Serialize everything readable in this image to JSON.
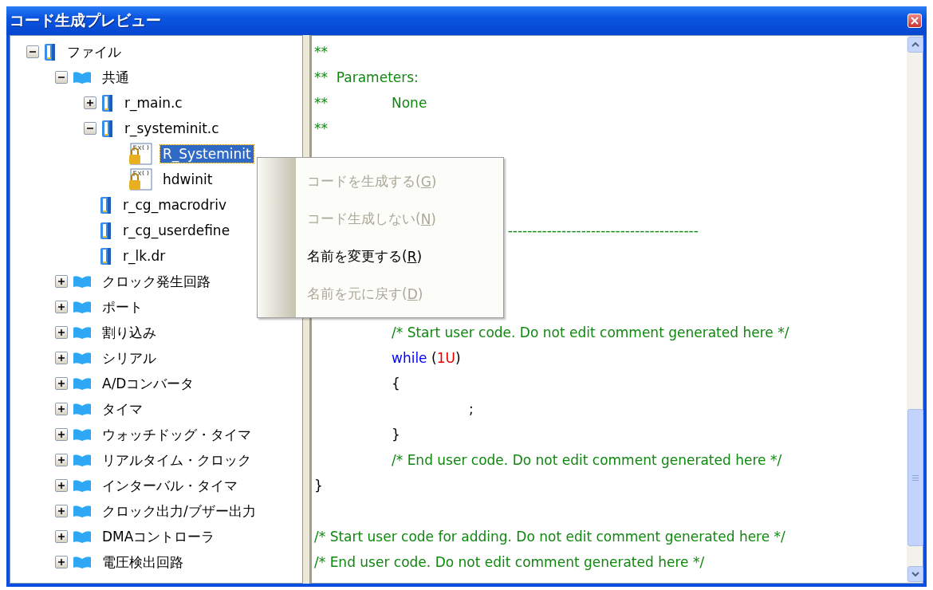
{
  "window": {
    "title": "コード生成プレビュー"
  },
  "tree": [
    {
      "label": "ファイル",
      "kind": "file",
      "expanded": true,
      "selected": false,
      "children": [
        {
          "label": "共通",
          "kind": "folder",
          "expanded": true,
          "selected": false,
          "children": [
            {
              "label": "r_main.c",
              "kind": "file",
              "expanded": false,
              "selected": false
            },
            {
              "label": "r_systeminit.c",
              "kind": "file",
              "expanded": true,
              "selected": false,
              "children": [
                {
                  "label": "R_Systeminit",
                  "kind": "function",
                  "selected": true
                },
                {
                  "label": "hdwinit",
                  "kind": "function",
                  "selected": false
                }
              ]
            },
            {
              "label": "r_cg_macrodriv",
              "kind": "file",
              "selected": false
            },
            {
              "label": "r_cg_userdefine",
              "kind": "file",
              "selected": false
            },
            {
              "label": "r_lk.dr",
              "kind": "file",
              "selected": false
            }
          ]
        },
        {
          "label": "クロック発生回路",
          "kind": "folder",
          "expanded": false,
          "selected": false
        },
        {
          "label": "ポート",
          "kind": "folder",
          "expanded": false,
          "selected": false
        },
        {
          "label": "割り込み",
          "kind": "folder",
          "expanded": false,
          "selected": false
        },
        {
          "label": "シリアル",
          "kind": "folder",
          "expanded": false,
          "selected": false
        },
        {
          "label": "A/Dコンバータ",
          "kind": "folder",
          "expanded": false,
          "selected": false
        },
        {
          "label": "タイマ",
          "kind": "folder",
          "expanded": false,
          "selected": false
        },
        {
          "label": "ウォッチドッグ・タイマ",
          "kind": "folder",
          "expanded": false,
          "selected": false
        },
        {
          "label": "リアルタイム・クロック",
          "kind": "folder",
          "expanded": false,
          "selected": false
        },
        {
          "label": "インターバル・タイマ",
          "kind": "folder",
          "expanded": false,
          "selected": false
        },
        {
          "label": "クロック出力/ブザー出力",
          "kind": "folder",
          "expanded": false,
          "selected": false
        },
        {
          "label": "DMAコントローラ",
          "kind": "folder",
          "expanded": false,
          "selected": false
        },
        {
          "label": "電圧検出回路",
          "kind": "folder",
          "expanded": false,
          "selected": false
        }
      ]
    }
  ],
  "code": [
    {
      "kind": "code",
      "segments": [
        {
          "kind": "comment",
          "text": "**"
        }
      ]
    },
    {
      "kind": "code",
      "segments": [
        {
          "kind": "comment",
          "text": "**  Parameters:"
        }
      ]
    },
    {
      "kind": "code",
      "segments": [
        {
          "kind": "comment",
          "text": "**\tNone"
        }
      ]
    },
    {
      "kind": "code",
      "segments": [
        {
          "kind": "comment",
          "text": "**"
        }
      ]
    },
    {
      "kind": "blank"
    },
    {
      "kind": "blank"
    },
    {
      "kind": "blank"
    },
    {
      "kind": "code",
      "segments": [
        {
          "kind": "comment",
          "text": "\t\t         ---------------------------------------"
        }
      ]
    },
    {
      "kind": "blank"
    },
    {
      "kind": "blank"
    },
    {
      "kind": "blank"
    },
    {
      "kind": "code",
      "segments": [
        {
          "kind": "comment",
          "text": "\t/* Start user code. Do not edit comment generated here */"
        }
      ]
    },
    {
      "kind": "code",
      "segments": [
        {
          "kind": "keyword",
          "text": "\twhile"
        },
        {
          "kind": "plain",
          "text": " ("
        },
        {
          "kind": "number",
          "text": "1U"
        },
        {
          "kind": "plain",
          "text": ")"
        }
      ]
    },
    {
      "kind": "code",
      "segments": [
        {
          "kind": "plain",
          "text": "\t{"
        }
      ]
    },
    {
      "kind": "code",
      "segments": [
        {
          "kind": "plain",
          "text": "\t\t;"
        }
      ]
    },
    {
      "kind": "code",
      "segments": [
        {
          "kind": "plain",
          "text": "\t}"
        }
      ]
    },
    {
      "kind": "code",
      "segments": [
        {
          "kind": "comment",
          "text": "\t/* End user code. Do not edit comment generated here */"
        }
      ]
    },
    {
      "kind": "code",
      "segments": [
        {
          "kind": "plain",
          "text": "}"
        }
      ]
    },
    {
      "kind": "blank"
    },
    {
      "kind": "code",
      "segments": [
        {
          "kind": "comment",
          "text": "/* Start user code for adding. Do not edit comment generated here */"
        }
      ]
    },
    {
      "kind": "code",
      "segments": [
        {
          "kind": "comment",
          "text": "/* End user code. Do not edit comment generated here */"
        }
      ]
    }
  ],
  "context_menu": [
    {
      "before": "コードを生成する(",
      "key": "G",
      "after": ")",
      "disabled": true
    },
    {
      "before": "コード生成しない(",
      "key": "N",
      "after": ")",
      "disabled": true
    },
    {
      "before": "名前を変更する(",
      "key": "R",
      "after": ")",
      "disabled": false
    },
    {
      "before": "名前を元に戻す(",
      "key": "D",
      "after": ")",
      "disabled": true
    }
  ]
}
